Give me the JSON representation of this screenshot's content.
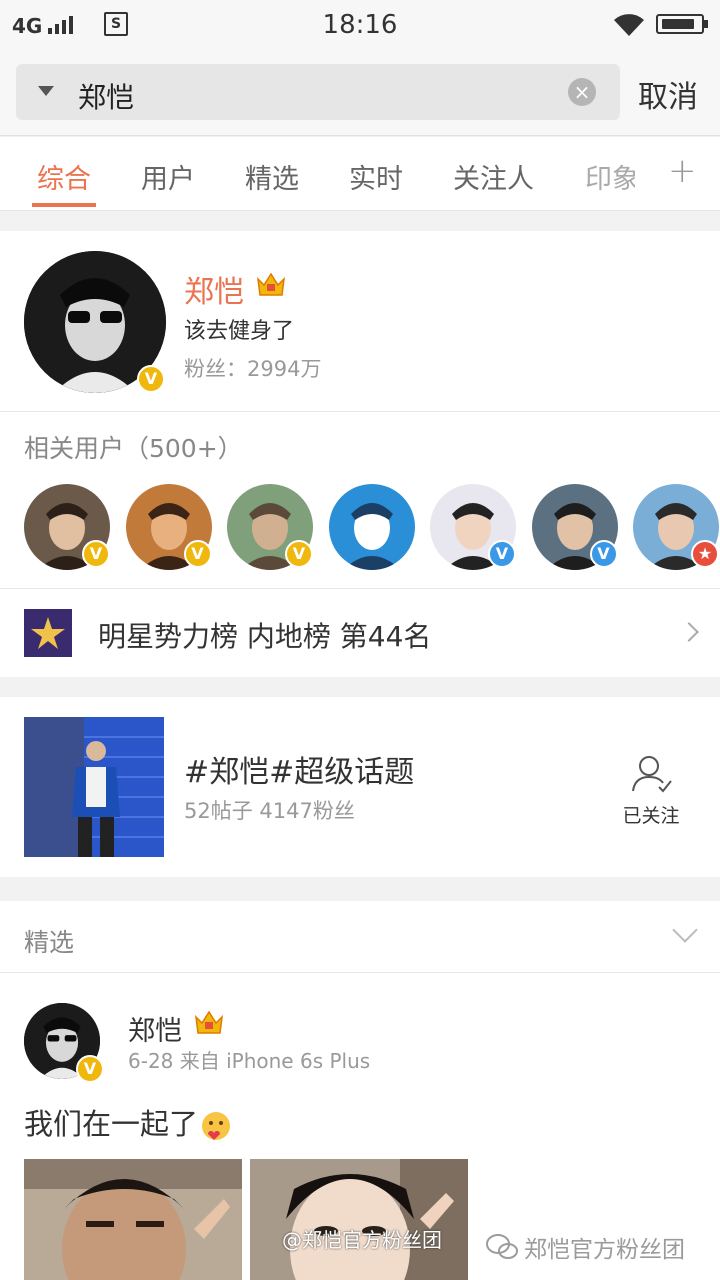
{
  "status_bar": {
    "network": "4G",
    "time": "18:16",
    "battery_level": 0.85
  },
  "search": {
    "query": "郑恺",
    "cancel_label": "取消"
  },
  "tabs": [
    {
      "label": "综合",
      "active": true
    },
    {
      "label": "用户"
    },
    {
      "label": "精选"
    },
    {
      "label": "实时"
    },
    {
      "label": "关注人"
    },
    {
      "label": "印象"
    }
  ],
  "profile": {
    "name": "郑恺",
    "bio": "该去健身了",
    "fans": "粉丝：2994万",
    "verified": true
  },
  "related_users": {
    "title": "相关用户（500+）",
    "badges": [
      "yellow",
      "yellow",
      "yellow",
      "none",
      "blue",
      "blue",
      "red"
    ]
  },
  "rank": {
    "text": "明星势力榜 内地榜 第44名"
  },
  "topic": {
    "title": "#郑恺#超级话题",
    "stats": "52帖子  4147粉丝",
    "follow_label": "已关注"
  },
  "featured": {
    "title": "精选",
    "post": {
      "author": "郑恺",
      "meta": "6-28  来自 iPhone 6s Plus",
      "text": "我们在一起了"
    }
  },
  "watermarks": {
    "image_caption": "@郑恺官方粉丝团",
    "wechat": "郑恺官方粉丝团"
  },
  "colors": {
    "accent": "#eb7350",
    "verified_gold": "#f0b70d",
    "verified_blue": "#3a98e6"
  }
}
